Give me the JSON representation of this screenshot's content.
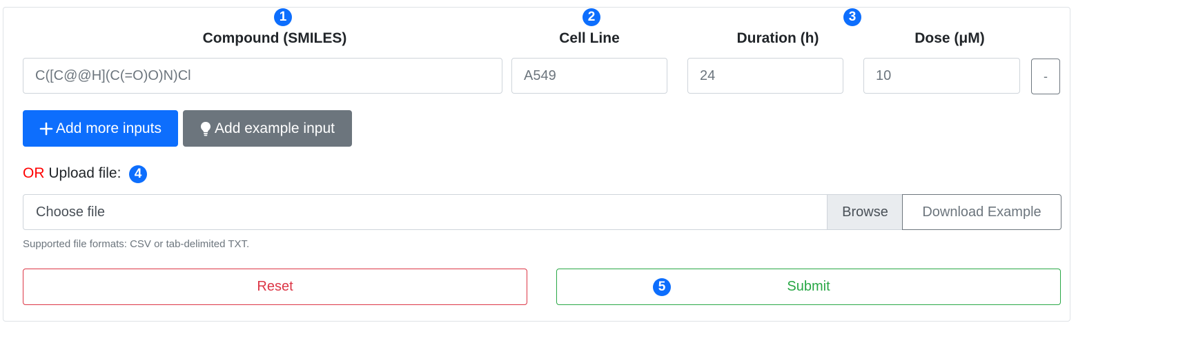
{
  "headers": {
    "compound": "Compound (SMILES)",
    "cell_line": "Cell Line",
    "duration": "Duration (h)",
    "dose": "Dose (μM)"
  },
  "inputs": {
    "compound_placeholder": "C([C@@H](C(=O)O)N)Cl",
    "cell_line_placeholder": "A549",
    "duration_placeholder": "24",
    "dose_placeholder": "10"
  },
  "buttons": {
    "remove": "-",
    "add_more": "Add more inputs",
    "add_example": "Add example input",
    "reset": "Reset",
    "submit": "Submit"
  },
  "upload": {
    "or_text": "OR",
    "label": "Upload file:",
    "choose_file": "Choose file",
    "browse": "Browse",
    "download_example": "Download Example",
    "help": "Supported file formats: CSV or tab-delimited TXT."
  },
  "badges": [
    "1",
    "2",
    "3",
    "4",
    "5"
  ],
  "colors": {
    "badge": "#0d6efd",
    "primary": "#0d6efd",
    "secondary": "#6c757d",
    "danger": "#dc3545",
    "success": "#28a745",
    "or_text": "#ff0000"
  },
  "icons": {
    "add_more": "plus-icon",
    "add_example": "lightbulb-icon"
  }
}
